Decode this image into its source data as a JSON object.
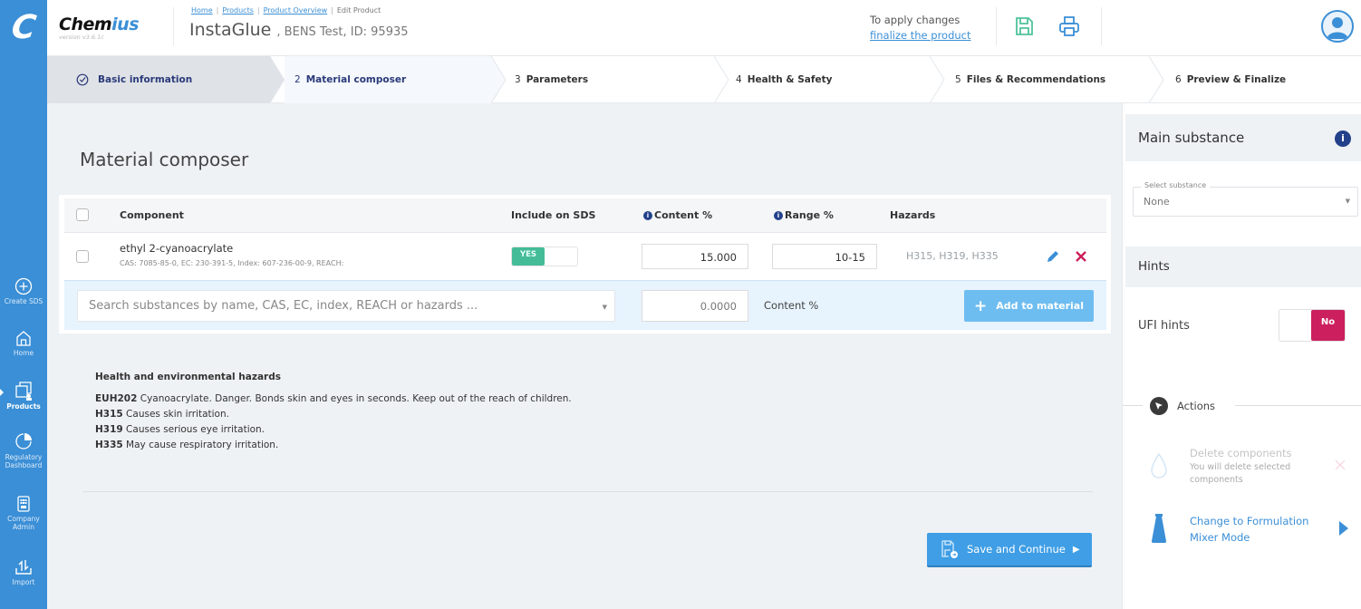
{
  "app": {
    "brand_prefix": "Chem",
    "brand_suffix": "ius",
    "version": "version v3.6.1c",
    "logo_letter": "C",
    "accent": "#3b8fd6"
  },
  "rail": {
    "items": [
      {
        "label": "Create SDS",
        "icon": "plus-circle-icon"
      },
      {
        "label": "Home",
        "icon": "home-icon"
      },
      {
        "label": "Products",
        "icon": "products-icon",
        "active": true
      },
      {
        "label_1": "Regulatory",
        "label_2": "Dashboard",
        "icon": "pie-chart-icon"
      },
      {
        "label_1": "Company",
        "label_2": "Admin",
        "icon": "calculator-icon"
      },
      {
        "label": "Import",
        "icon": "import-icon"
      }
    ]
  },
  "header": {
    "breadcrumb": [
      "Home",
      "Products",
      "Product Overview",
      "Edit Product"
    ],
    "title": "InstaGlue",
    "subtitle": ", BENS Test, ID: 95935",
    "apply_text": "To apply changes",
    "apply_link": "finalize the product"
  },
  "steps": [
    {
      "num": "",
      "label": "Basic information",
      "state": "done"
    },
    {
      "num": "2",
      "label": "Material composer",
      "state": "current"
    },
    {
      "num": "3",
      "label": "Parameters",
      "state": "todo"
    },
    {
      "num": "4",
      "label": "Health & Safety",
      "state": "todo"
    },
    {
      "num": "5",
      "label": "Files & Recommendations",
      "state": "todo"
    },
    {
      "num": "6",
      "label": "Preview & Finalize",
      "state": "todo"
    }
  ],
  "main": {
    "heading": "Material composer",
    "table": {
      "columns": [
        "Component",
        "Include on SDS",
        "Content %",
        "Range %",
        "Hazards"
      ],
      "rows": [
        {
          "name": "ethyl 2-cyanoacrylate",
          "ids": "CAS: 7085-85-0, EC: 230-391-5, Index: 607-236-00-9, REACH:",
          "include": "YES",
          "content": "15.000",
          "range": "10-15",
          "hazards": "H315, H319, H335"
        }
      ]
    },
    "add_row": {
      "search_placeholder": "Search substances by name, CAS, EC, index, REACH or hazards ...",
      "content_value": "0.0000",
      "content_label": "Content %",
      "add_button": "Add to material"
    },
    "hazards_block": {
      "title": "Health and environmental hazards",
      "items": [
        {
          "code": "EUH202",
          "text": " Cyanoacrylate. Danger. Bonds skin and eyes in seconds. Keep out of the reach of children."
        },
        {
          "code": "H315",
          "text": " Causes skin irritation."
        },
        {
          "code": "H319",
          "text": " Causes serious eye irritation."
        },
        {
          "code": "H335",
          "text": " May cause respiratory irritation."
        }
      ]
    },
    "save_button": "Save and Continue"
  },
  "side": {
    "main_substance_title": "Main substance",
    "select_label": "Select substance",
    "select_value": "None",
    "hints_title": "Hints",
    "ufi_label": "UFI hints",
    "ufi_value": "No",
    "actions_title": "Actions",
    "actions": [
      {
        "title": "Delete components",
        "subtitle_1": "You will delete selected",
        "subtitle_2": "components",
        "disabled": true
      },
      {
        "title_1": "Change to Formulation",
        "title_2": "Mixer Mode",
        "disabled": false
      }
    ]
  }
}
